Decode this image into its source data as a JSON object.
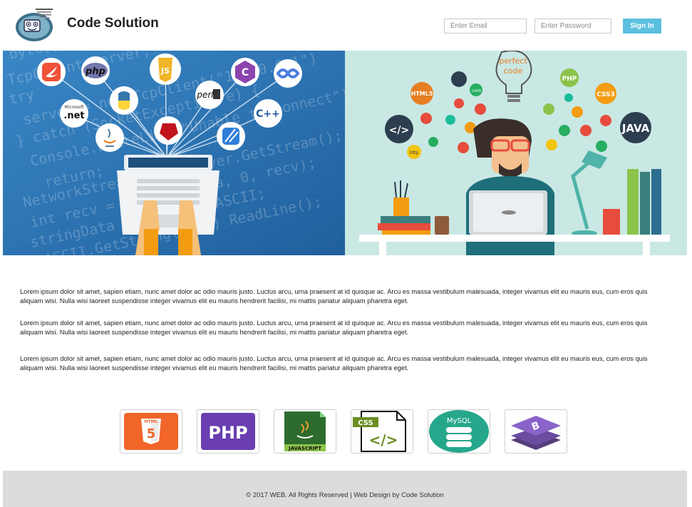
{
  "header": {
    "brand": "Code Solution",
    "email_placeholder": "Enter Email",
    "password_placeholder": "Enter Password",
    "signin_label": "Sign In"
  },
  "hero": {
    "left_code_text": [
      "byte[]",
      "TcpClient server;",
      "try",
      "server = new TcpClient(",
      "} catch (SocketException",
      "Console.WriteLine(",
      "return;",
      "NetworkStream ns =",
      "int recv =",
      "stringData",
      "ASCII.GetString",
      "Console.WriteLine();",
      "ReadLine()",
      "break;"
    ],
    "left_icons": [
      "swift-icon",
      "php-icon",
      "dotnet-icon",
      "python-icon",
      "java-icon",
      "javascript-icon",
      "ruby-icon",
      "perl-icon",
      "csharp-icon",
      "cpp-icon",
      "objective-c-icon",
      "xcode-icon"
    ],
    "left_icon_labels": {
      "php": "php",
      "dotnet": "Microsoft .net",
      "perl": "perl",
      "cpp": "C++"
    },
    "right_labels": {
      "perfect_code": "perfect code",
      "html5": "HTML5",
      "php": "PHP",
      "css3": "CSS3",
      "java": "JAVA",
      "com": ".com",
      "http": "http",
      "code_tag": "</>"
    }
  },
  "content": {
    "paragraphs": [
      "Lorem ipsum dolor sit amet, sapien etiam, nunc amet dolor ac odio mauris justo. Luctus arcu, urna praesent at id quisque ac. Arcu es massa vestibulum malesuada, integer vivamus elit eu mauris eus, cum eros quis aliquam wisi. Nulla wisi laoreet suspendisse integer vivamus elit eu mauris hendrerit facilisi, mi mattis pariatur aliquam pharetra eget.",
      "Lorem ipsum dolor sit amet, sapien etiam, nunc amet dolor ac odio mauris justo. Luctus arcu, urna praesent at id quisque ac. Arcu es massa vestibulum malesuada, integer vivamus elit eu mauris eus, cum eros quis aliquam wisi. Nulla wisi laoreet suspendisse integer vivamus elit eu mauris hendrerit facilisi, mi mattis pariatur aliquam pharetra eget.",
      "Lorem ipsum dolor sit amet, sapien etiam, nunc amet dolor ac odio mauris justo. Luctus arcu, urna praesent at id quisque ac. Arcu es massa vestibulum malesuada, integer vivamus elit eu mauris eus, cum eros quis aliquam wisi. Nulla wisi laoreet suspendisse integer vivamus elit eu mauris hendrerit facilisi, mi mattis pariatur aliquam pharetra eget."
    ]
  },
  "tech": {
    "html5": "HTML",
    "html5_num": "5",
    "php": "PHP",
    "javascript": "JAVASCRIPT",
    "css": "CSS",
    "css_code": "</>",
    "mysql": "MySQL",
    "bootstrap": "B"
  },
  "footer": {
    "text": "© 2017 WEB. All Rights Reserved | Web Design by Code Solution"
  },
  "colors": {
    "signin": "#5bc0de",
    "hero_left_bg": "#2e78b8",
    "hero_right_bg": "#c7e6e2",
    "footer_bg": "#dcdcdc"
  }
}
